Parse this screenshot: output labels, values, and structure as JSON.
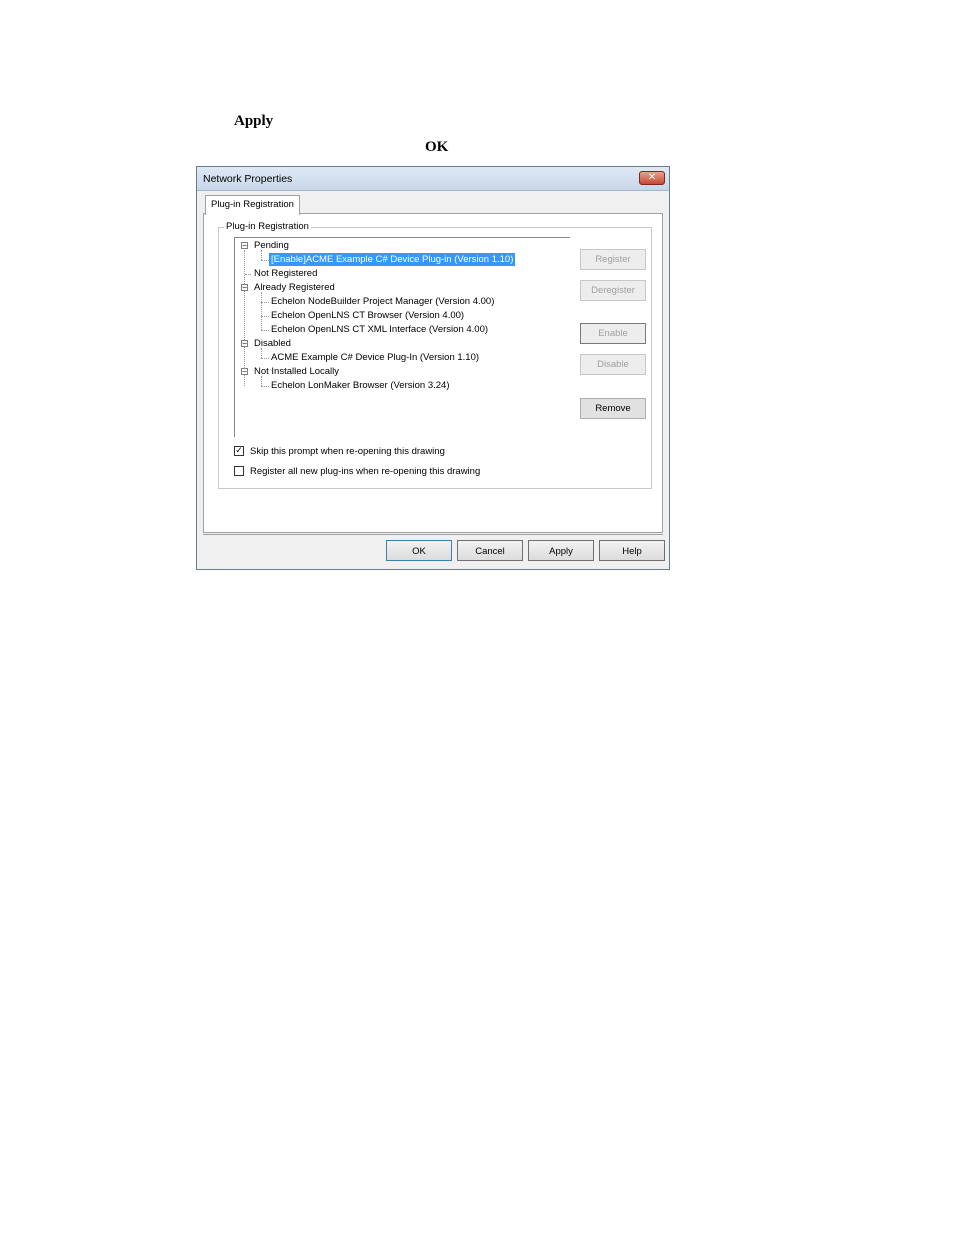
{
  "document": {
    "word_apply": "Apply",
    "word_ok": "OK"
  },
  "dialog": {
    "title": "Network Properties",
    "close_glyph": "✕",
    "tab_label": "Plug-in Registration",
    "group_label": "Plug-in Registration",
    "tree": {
      "pending": "Pending",
      "pending_item": "[Enable]ACME Example C# Device Plug-in (Version 1.10)",
      "not_registered": "Not Registered",
      "already_registered": "Already Registered",
      "already_items": [
        "Echelon NodeBuilder Project Manager (Version 4.00)",
        "Echelon OpenLNS CT Browser (Version 4.00)",
        "Echelon OpenLNS CT XML Interface (Version 4.00)"
      ],
      "disabled": "Disabled",
      "disabled_item": "ACME Example C# Device Plug-In (Version 1.10)",
      "not_installed": "Not Installed Locally",
      "not_installed_item": "Echelon LonMaker Browser (Version 3.24)",
      "expander_glyph": "−"
    },
    "side_buttons": {
      "register": "Register",
      "deregister": "Deregister",
      "enable": "Enable",
      "disable": "Disable",
      "remove": "Remove"
    },
    "checkboxes": {
      "skip_prompt": "Skip this prompt when re-opening this drawing",
      "skip_prompt_checked": true,
      "register_all": "Register all new plug-ins when re-opening this drawing",
      "register_all_checked": false,
      "check_glyph": "✓"
    },
    "footer_buttons": {
      "ok": "OK",
      "cancel": "Cancel",
      "apply": "Apply",
      "help": "Help"
    }
  }
}
